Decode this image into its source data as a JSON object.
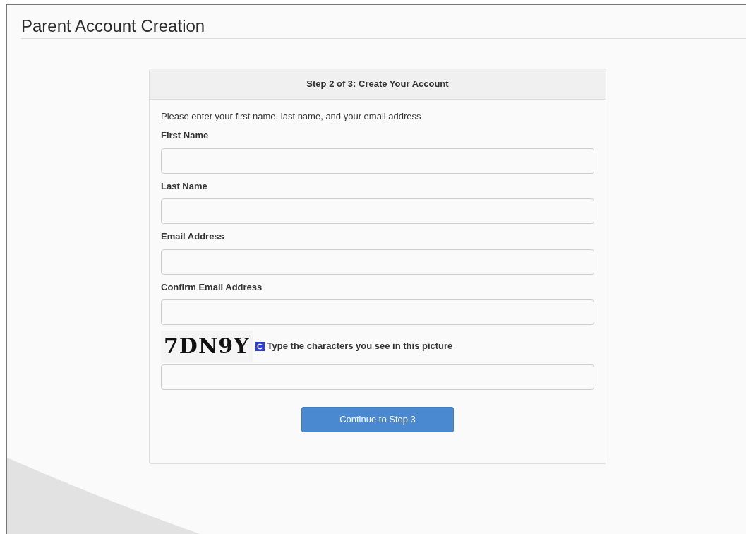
{
  "page_title": "Parent Account Creation",
  "panel": {
    "heading": "Step 2 of 3: Create Your Account",
    "intro": "Please enter your first name, last name, and your email address",
    "fields": [
      {
        "label": "First Name"
      },
      {
        "label": "Last Name"
      },
      {
        "label": "Email Address"
      },
      {
        "label": "Confirm Email Address"
      }
    ],
    "captcha": {
      "code": "7DN9Y",
      "instruction": "Type the characters you see in this picture"
    },
    "submit": "Continue to Step 3"
  }
}
